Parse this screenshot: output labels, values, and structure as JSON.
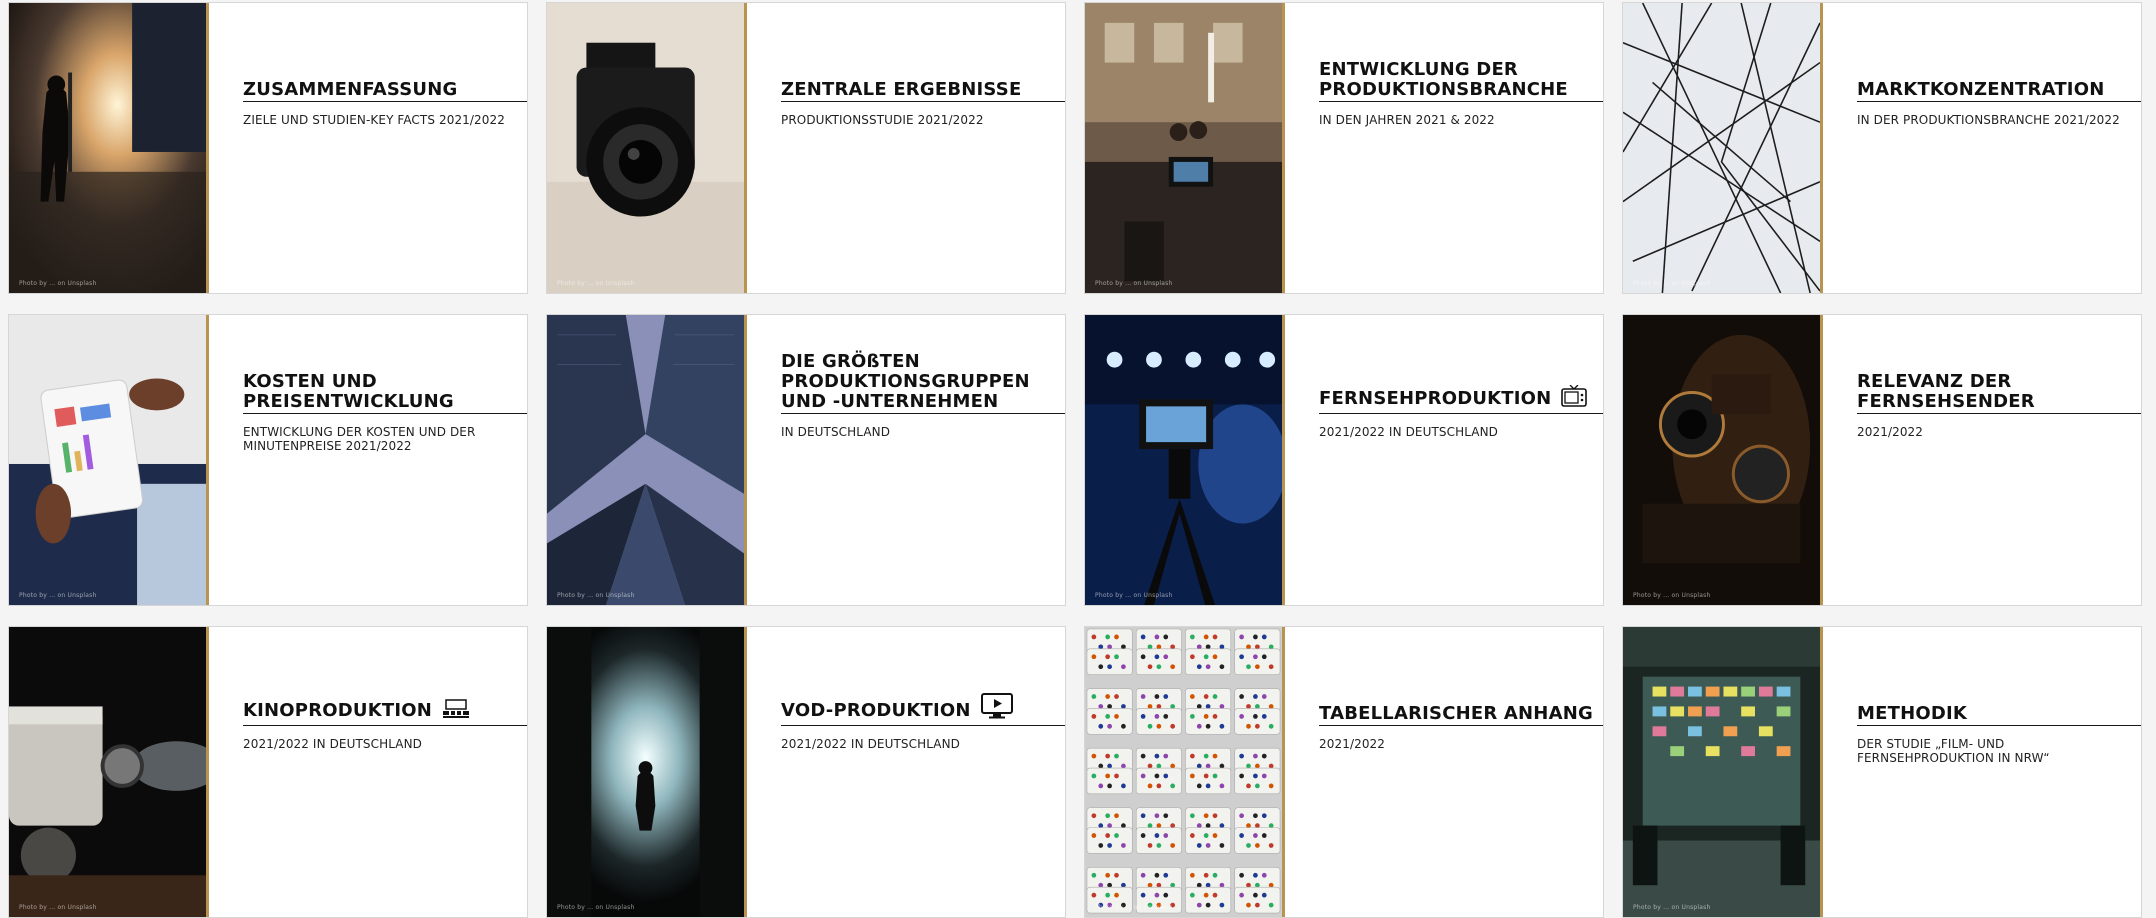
{
  "cards": [
    {
      "title": "ZUSAMMENFASSUNG",
      "subtitle": "ZIELE UND STUDIEN-KEY FACTS 2021/2022",
      "credit": "Photo by ... on Unsplash"
    },
    {
      "title": "ZENTRALE ERGEBNISSE",
      "subtitle": "PRODUKTIONSSTUDIE 2021/2022",
      "credit": "Photo by ... on Unsplash"
    },
    {
      "title": "ENTWICKLUNG DER\nPRODUKTIONSBRANCHE",
      "subtitle": "IN DEN JAHREN 2021 & 2022",
      "credit": "Photo by ... on Unsplash"
    },
    {
      "title": "MARKTKONZENTRATION",
      "subtitle": "IN DER PRODUKTIONSBRANCHE 2021/2022",
      "credit": "Photo by ... on Unsplash"
    },
    {
      "title": "KOSTEN UND\nPREISENTWICKLUNG",
      "subtitle": "ENTWICKLUNG DER KOSTEN UND DER\nMINUTENPREISE 2021/2022",
      "credit": "Photo by ... on Unsplash"
    },
    {
      "title": "DIE GRÖßTEN\nPRODUKTIONSGRUPPEN\nUND -UNTERNEHMEN",
      "subtitle": "IN DEUTSCHLAND",
      "credit": "Photo by ... on Unsplash"
    },
    {
      "title": "FERNSEHPRODUKTION",
      "subtitle": "2021/2022 IN DEUTSCHLAND",
      "credit": "Photo by ... on Unsplash",
      "icon": "tv-icon"
    },
    {
      "title": "RELEVANZ DER\nFERNSEHSENDER",
      "subtitle": "2021/2022",
      "credit": "Photo by ... on Unsplash"
    },
    {
      "title": "KINOPRODUKTION",
      "subtitle": "2021/2022 IN DEUTSCHLAND",
      "credit": "Photo by ... on Unsplash",
      "icon": "cinema-icon"
    },
    {
      "title": "VOD-PRODUKTION",
      "subtitle": "2021/2022 IN DEUTSCHLAND",
      "credit": "Photo by ... on Unsplash",
      "icon": "monitor-play-icon"
    },
    {
      "title": "TABELLARISCHER ANHANG",
      "subtitle": "2021/2022",
      "credit": "Photo by ... on Unsplash"
    },
    {
      "title": "METHODIK",
      "subtitle": "DER STUDIE „FILM- UND\nFERNSEHPRODUKTION IN NRW“",
      "credit": "Photo by ... on Unsplash"
    }
  ],
  "colors": {
    "accent_border": "#b89450",
    "title_text": "#111111",
    "card_bg": "#ffffff"
  }
}
